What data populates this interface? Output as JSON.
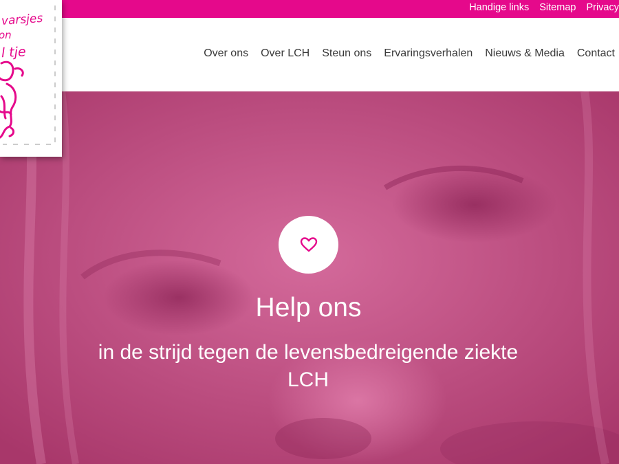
{
  "topbar": {
    "links": [
      "Handige links",
      "Sitemap",
      "Privacy"
    ]
  },
  "nav": {
    "items": [
      "Over ons",
      "Over LCH",
      "Steun ons",
      "Ervaringsverhalen",
      "Nieuws & Media",
      "Contact"
    ]
  },
  "logo": {
    "text_lines": [
      "varsjes",
      "on",
      "l tje"
    ]
  },
  "hero": {
    "icon": "heart-icon",
    "title": "Help ons",
    "subtitle": "in de strijd tegen de levensbedreigende ziekte LCH"
  },
  "colors": {
    "accent": "#e5098b",
    "hero_tint": "#c1487f",
    "nav_text": "#3a3a3a"
  }
}
